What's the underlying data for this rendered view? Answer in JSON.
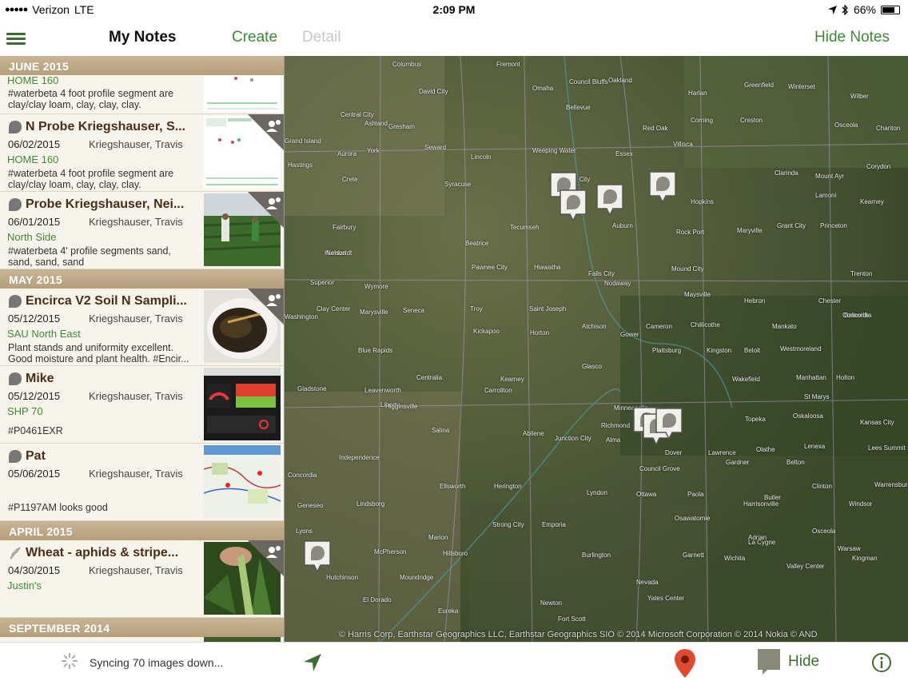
{
  "status": {
    "carrier": "Verizon",
    "network": "LTE",
    "time": "2:09 PM",
    "battery": "66%",
    "battery_level": 0.66
  },
  "nav": {
    "title": "My Notes",
    "create": "Create",
    "detail": "Detail",
    "hide_notes": "Hide Notes"
  },
  "sections": [
    {
      "header": "JUNE 2015",
      "partial_note": {
        "location": "HOME 160",
        "body": "#waterbeta 4 foot profile segment are clay/clay loam, clay, clay, clay."
      },
      "notes": [
        {
          "title": "N Probe Kriegshauser, S...",
          "date": "06/02/2015",
          "author": "Kriegshauser, Travis",
          "location": "HOME 160",
          "body": "#waterbeta 4 foot profile segment are clay/clay loam, clay, clay, clay."
        },
        {
          "title": "Probe Kriegshauser, Nei...",
          "date": "06/01/2015",
          "author": "Kriegshauser, Travis",
          "location": "North Side",
          "body": "#waterbeta 4' profile segments sand, sand, sand, sand"
        }
      ]
    },
    {
      "header": "MAY 2015",
      "notes": [
        {
          "title": "Encirca V2 Soil N Sampli...",
          "date": "05/12/2015",
          "author": "Kriegshauser, Travis",
          "location": "SAU North East",
          "body": "Plant stands and uniformity excellent. Good moisture and plant health. #Encir..."
        },
        {
          "title": "Mike",
          "date": "05/12/2015",
          "author": "Kriegshauser, Travis",
          "location": "SHP 70",
          "body": "#P0461EXR"
        },
        {
          "title": "Pat",
          "date": "05/06/2015",
          "author": "Kriegshauser, Travis",
          "location": "",
          "body": "#P1197AM looks good"
        }
      ]
    },
    {
      "header": "APRIL 2015",
      "notes": [
        {
          "title": "Wheat - aphids & stripe...",
          "date": "04/30/2015",
          "author": "Kriegshauser, Travis",
          "location": "Justin's",
          "body": ""
        }
      ]
    },
    {
      "header": "SEPTEMBER 2014",
      "notes": []
    }
  ],
  "map": {
    "attribution": "© Harris Corp, Earthstar Geographics LLC, Earthstar Geographics SIO © 2014 Microsoft Corporation © 2014 Nokia © AND",
    "cities": [
      "Columbus",
      "Fremont",
      "David City",
      "Omaha",
      "Council Bluffs",
      "Oakland",
      "Harlan",
      "Greenfield",
      "Winterset",
      "Wilber",
      "Central City",
      "Bellevue",
      "Red Oak",
      "Corning",
      "Creston",
      "Osceola",
      "Chariton",
      "Grand Island",
      "Aurora",
      "Gresham",
      "Ashland",
      "Seward",
      "York",
      "Lincoln",
      "Weeping Water",
      "Essex",
      "Villisca",
      "Clarinda",
      "Mount Ayr",
      "Corydon",
      "Hastings",
      "Crete",
      "Syracuse",
      "Nebraska City",
      "Hopkins",
      "Lamoni",
      "Kearney",
      "Fairbury",
      "Tecumseh",
      "Auburn",
      "Rock Port",
      "Maryville",
      "Grant City",
      "Princeton",
      "Beatrice",
      "Humboldt",
      "Falls City",
      "Mound City",
      "Trenton",
      "Nelson",
      "Superior",
      "Wymore",
      "Pawnee City",
      "Hiawatha",
      "Nodaway",
      "Maysville",
      "Hebron",
      "Chester",
      "Belleville",
      "Washington",
      "Marysville",
      "Seneca",
      "Troy",
      "Saint Joseph",
      "Cameron",
      "Chillicothe",
      "Mankato",
      "Concordia",
      "Clay Center",
      "Blue Rapids",
      "Centralia",
      "Kickapoo",
      "Horton",
      "Atchison",
      "Gower",
      "Plattsburg",
      "Kingston",
      "Beloit",
      "Westmoreland",
      "Holton",
      "Leavenworth",
      "Kearney",
      "Carrollton",
      "Glasco",
      "Manhattan",
      "Wakefield",
      "St Marys",
      "Gladstone",
      "Liberty",
      "Richmond",
      "Minneapolis",
      "Topeka",
      "Oskaloosa",
      "Kansas City",
      "Independence",
      "Higginsville",
      "Salina",
      "Abilene",
      "Junction City",
      "Alma",
      "Dover",
      "Lawrence",
      "Olathe",
      "Lenexa",
      "Lees Summit",
      "Concordia",
      "Ellsworth",
      "Herington",
      "Council Grove",
      "Gardner",
      "Belton",
      "Warrensburg",
      "Lindsborg",
      "Lyndon",
      "Ottawa",
      "Paola",
      "Harrisonville",
      "Clinton",
      "Geneseo",
      "Marion",
      "Strong City",
      "Emporia",
      "Osawatomie",
      "Butler",
      "Windsor",
      "Lyons",
      "McPherson",
      "Hillsboro",
      "Burlington",
      "Garnett",
      "Adrian",
      "Warsaw",
      "Hutchinson",
      "Moundridge",
      "Newton",
      "Yates Center",
      "La Cygne",
      "Osceola",
      "Valley Center",
      "El Dorado",
      "Eureka",
      "Fort Scott",
      "Nevada",
      "Wichita",
      "Kingman"
    ],
    "pin_count": 8
  },
  "bottom": {
    "sync_text": "Syncing 70 images down...",
    "hide_label": "Hide"
  },
  "colors": {
    "accent_green": "#3d8a35",
    "section_tan": "#bda985",
    "title_brown": "#4a2e18"
  }
}
